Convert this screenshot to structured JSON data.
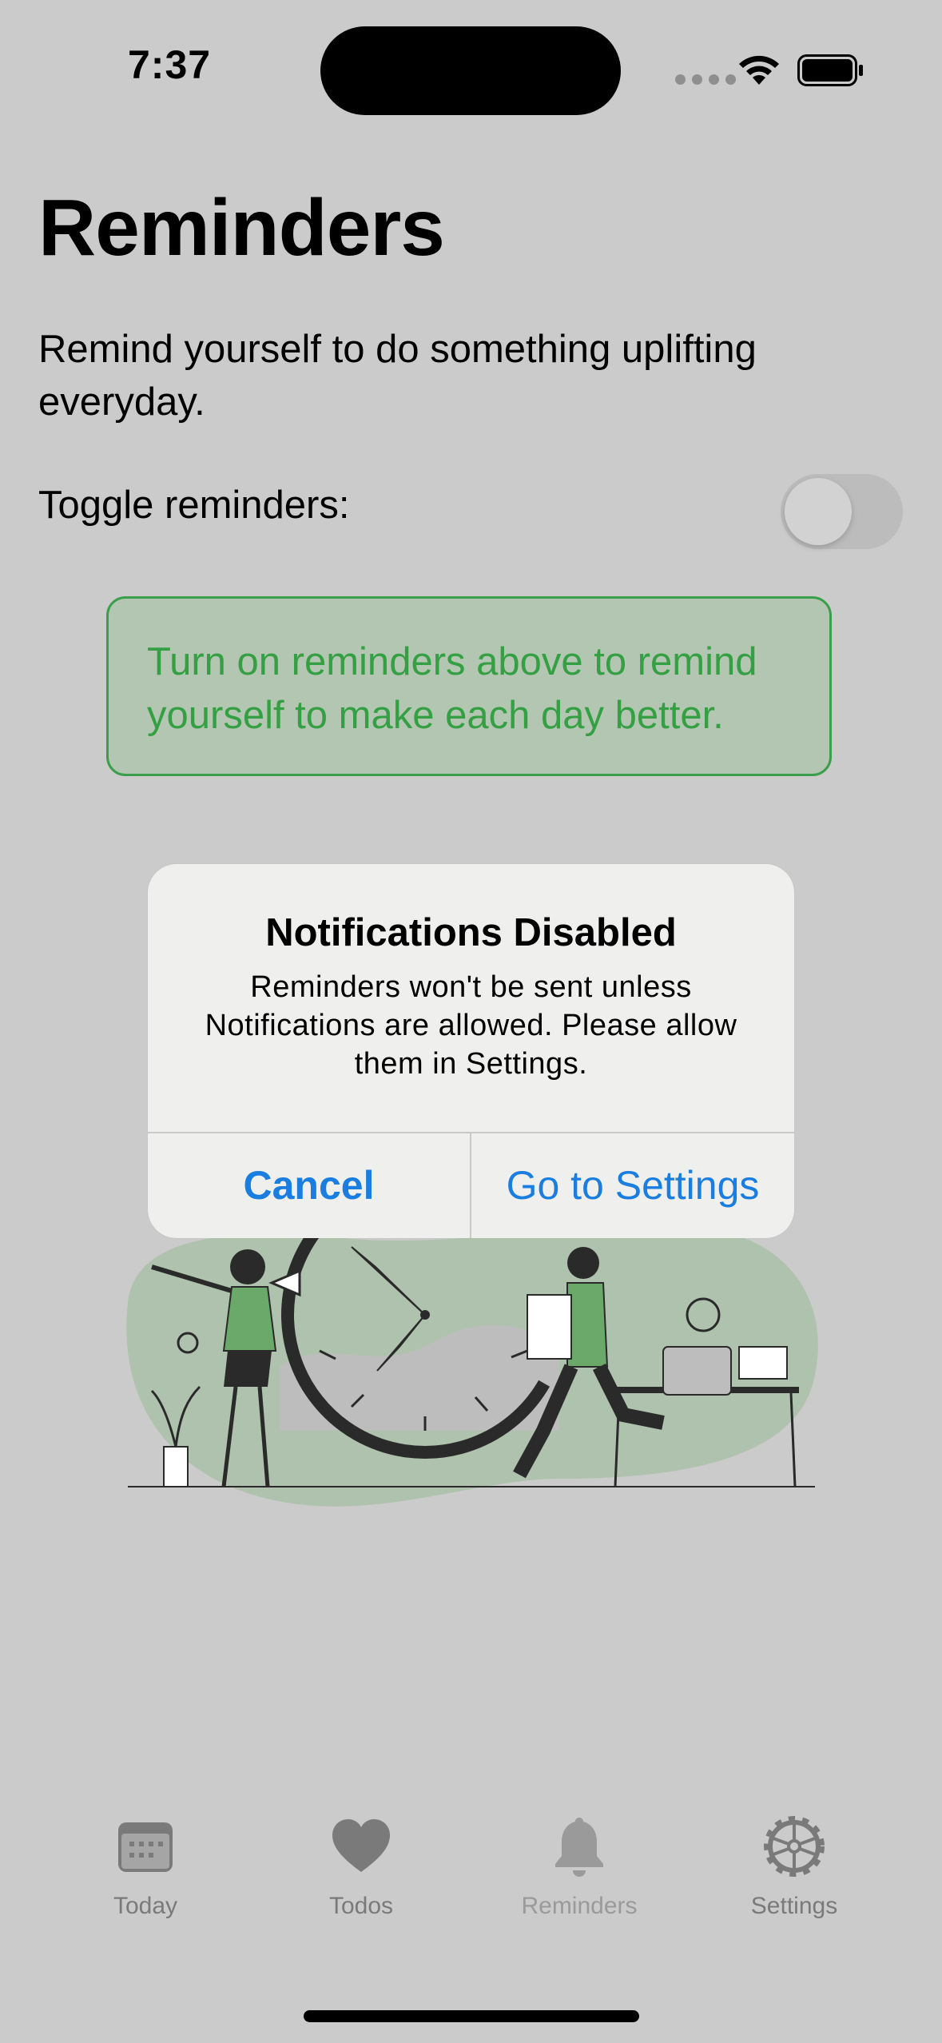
{
  "status_bar": {
    "time": "7:37"
  },
  "page": {
    "title": "Reminders",
    "description": "Remind yourself to do something uplifting everyday.",
    "toggle_label": "Toggle reminders:",
    "toggle_on": false,
    "hint": "Turn on reminders above to remind yourself to make each day better."
  },
  "alert": {
    "title": "Notifications Disabled",
    "message": "Reminders won't be sent unless Notifications are allowed. Please allow them in Settings.",
    "cancel_label": "Cancel",
    "settings_label": "Go to Settings"
  },
  "tab_bar": {
    "items": [
      {
        "label": "Today",
        "icon": "calendar-icon"
      },
      {
        "label": "Todos",
        "icon": "heart-icon"
      },
      {
        "label": "Reminders",
        "icon": "bell-icon"
      },
      {
        "label": "Settings",
        "icon": "gear-icon"
      }
    ],
    "selected": "Reminders"
  },
  "colors": {
    "accent_blue": "#1a7de0",
    "hint_green": "#35a043",
    "background": "#cbcbcb"
  }
}
